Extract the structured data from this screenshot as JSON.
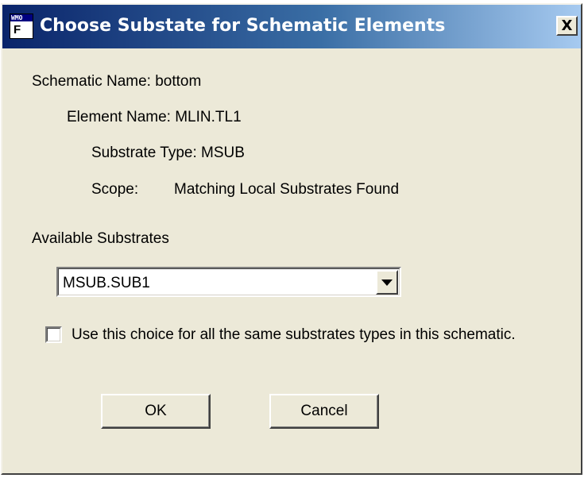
{
  "window": {
    "title": "Choose Substate for Schematic Elements",
    "icon_text": "WMO",
    "icon_glyph": "F",
    "close_label": "X"
  },
  "info": {
    "schematic_name": "Schematic Name:  bottom",
    "element_name": "Element Name: MLIN.TL1",
    "substrate_type": "Substrate Type:   MSUB",
    "scope_label": "Scope:",
    "scope_value": "Matching Local Substrates Found"
  },
  "substrates": {
    "label": "Available Substrates",
    "selected": "MSUB.SUB1"
  },
  "checkbox": {
    "label": "Use this choice for all the same substrates types in this schematic.",
    "checked": false
  },
  "buttons": {
    "ok": "OK",
    "cancel": "Cancel"
  },
  "colors": {
    "dialog_face": "#ece9d8",
    "title_start": "#0a246a",
    "title_end": "#a6caf0"
  }
}
